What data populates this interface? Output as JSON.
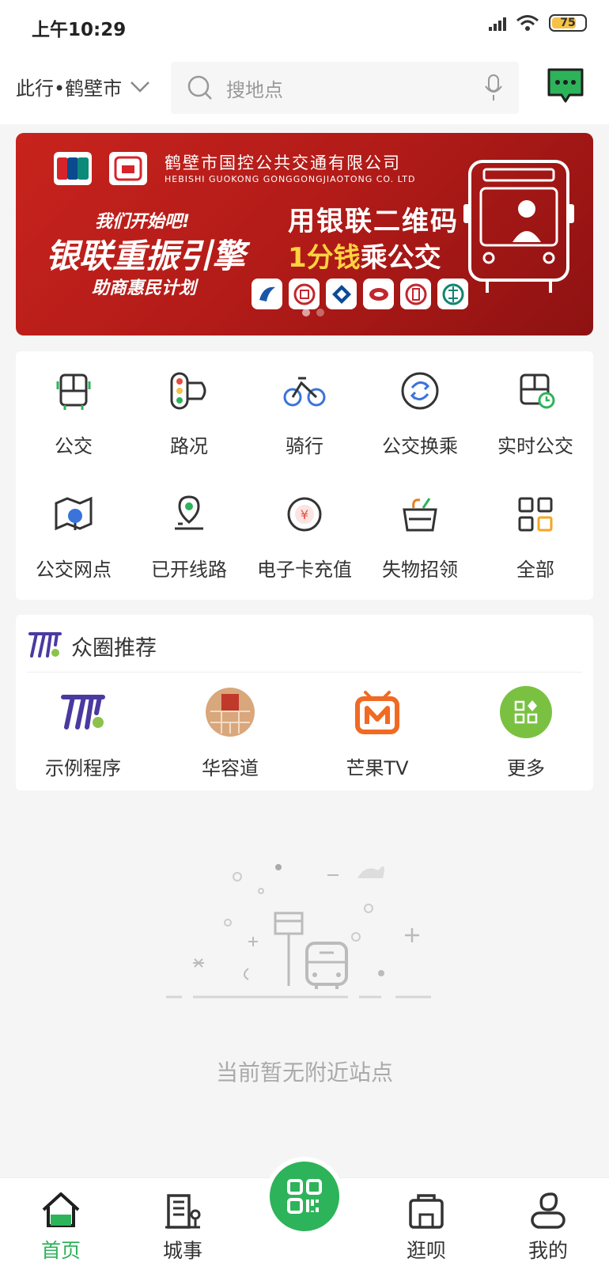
{
  "status_bar": {
    "time": "上午10:29",
    "battery": "75",
    "battery_level": 0.75
  },
  "header": {
    "city": "此行•鹤壁市",
    "search_placeholder": "搜地点"
  },
  "banner": {
    "company_cn": "鹤壁市国控公共交通有限公司",
    "company_en": "HEBISHI GUOKONG GONGGONGJIAOTONG CO. LTD",
    "slogan_small": "我们开始吧!",
    "slogan_big": "银联重振引擎",
    "slogan_sub": "助商惠民计划",
    "qr_line1": "用银联二维码",
    "qr_line2_highlight": "1分钱",
    "qr_line2_rest": "乘公交",
    "unionpay": "UnionPay 银联",
    "cloudpay": "云闪付",
    "page_count": 2,
    "current_page": 1
  },
  "quick_menu": [
    {
      "label": "公交",
      "icon": "bus-icon"
    },
    {
      "label": "路况",
      "icon": "traffic-light-icon"
    },
    {
      "label": "骑行",
      "icon": "bicycle-icon"
    },
    {
      "label": "公交换乘",
      "icon": "transfer-icon"
    },
    {
      "label": "实时公交",
      "icon": "realtime-bus-icon"
    },
    {
      "label": "公交网点",
      "icon": "map-pin-icon"
    },
    {
      "label": "已开线路",
      "icon": "route-icon"
    },
    {
      "label": "电子卡充值",
      "icon": "recharge-icon"
    },
    {
      "label": "失物招领",
      "icon": "basket-icon"
    },
    {
      "label": "全部",
      "icon": "grid-icon"
    }
  ],
  "circle": {
    "title": "众圈推荐",
    "apps": [
      {
        "label": "示例程序",
        "icon": "sample-app-icon"
      },
      {
        "label": "华容道",
        "icon": "huarongdao-icon"
      },
      {
        "label": "芒果TV",
        "icon": "mango-tv-icon"
      },
      {
        "label": "更多",
        "icon": "more-apps-icon"
      }
    ]
  },
  "empty": {
    "text": "当前暂无附近站点"
  },
  "tabs": [
    {
      "label": "首页",
      "icon": "home-icon",
      "active": true
    },
    {
      "label": "城事",
      "icon": "city-icon",
      "active": false
    },
    {
      "label": "逛呗",
      "icon": "shop-icon",
      "active": false
    },
    {
      "label": "我的",
      "icon": "profile-icon",
      "active": false
    }
  ],
  "colors": {
    "accent": "#2db35a",
    "banner_red": "#c8231d",
    "highlight_yellow": "#ffd23f"
  }
}
